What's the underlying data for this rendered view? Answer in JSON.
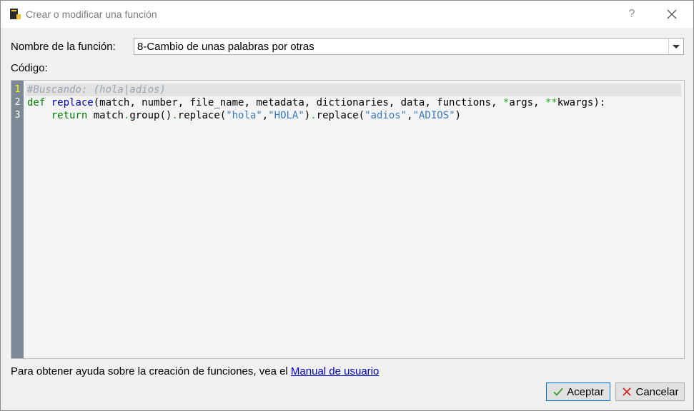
{
  "window": {
    "title": "Crear o modificar una función",
    "help_label": "?",
    "close_label": "✕"
  },
  "form": {
    "name_label": "Nombre de la función:",
    "name_value": "8-Cambio de unas palabras por otras",
    "code_label": "Código:"
  },
  "editor": {
    "line_numbers": [
      "1",
      "2",
      "3"
    ],
    "lines": [
      [
        {
          "t": "#Buscando: (hola|adios)",
          "c": "cmt"
        }
      ],
      [
        {
          "t": "def",
          "c": "kw"
        },
        {
          "t": " "
        },
        {
          "t": "replace",
          "c": "fn"
        },
        {
          "t": "(match, number, file_name, metadata, dictionaries, data, functions, "
        },
        {
          "t": "*",
          "c": "op"
        },
        {
          "t": "args, "
        },
        {
          "t": "**",
          "c": "op"
        },
        {
          "t": "kwargs):"
        }
      ],
      [
        {
          "t": "    "
        },
        {
          "t": "return",
          "c": "kw"
        },
        {
          "t": " match"
        },
        {
          "t": ".",
          "c": "op"
        },
        {
          "t": "group()"
        },
        {
          "t": ".",
          "c": "op"
        },
        {
          "t": "replace("
        },
        {
          "t": "\"hola\"",
          "c": "str"
        },
        {
          "t": ","
        },
        {
          "t": "\"HOLA\"",
          "c": "str"
        },
        {
          "t": ")"
        },
        {
          "t": ".",
          "c": "op"
        },
        {
          "t": "replace("
        },
        {
          "t": "\"adios\"",
          "c": "str"
        },
        {
          "t": ","
        },
        {
          "t": "\"ADIOS\"",
          "c": "str"
        },
        {
          "t": ")"
        }
      ]
    ]
  },
  "help": {
    "text": "Para obtener ayuda sobre la creación de funciones, vea el ",
    "link": "Manual de usuario"
  },
  "buttons": {
    "accept": "Aceptar",
    "cancel": "Cancelar"
  },
  "colors": {
    "gutter": "#7b8896",
    "keyword": "#008000",
    "function": "#0000aa",
    "string": "#3a7bbf",
    "comment": "#99a4b4",
    "accept_icon": "#2e9e2e",
    "cancel_icon": "#d32020"
  },
  "icons": {
    "app": "calibre-book-icon",
    "accept": "checkmark-icon",
    "cancel": "x-icon",
    "combo": "chevron-down-icon"
  }
}
